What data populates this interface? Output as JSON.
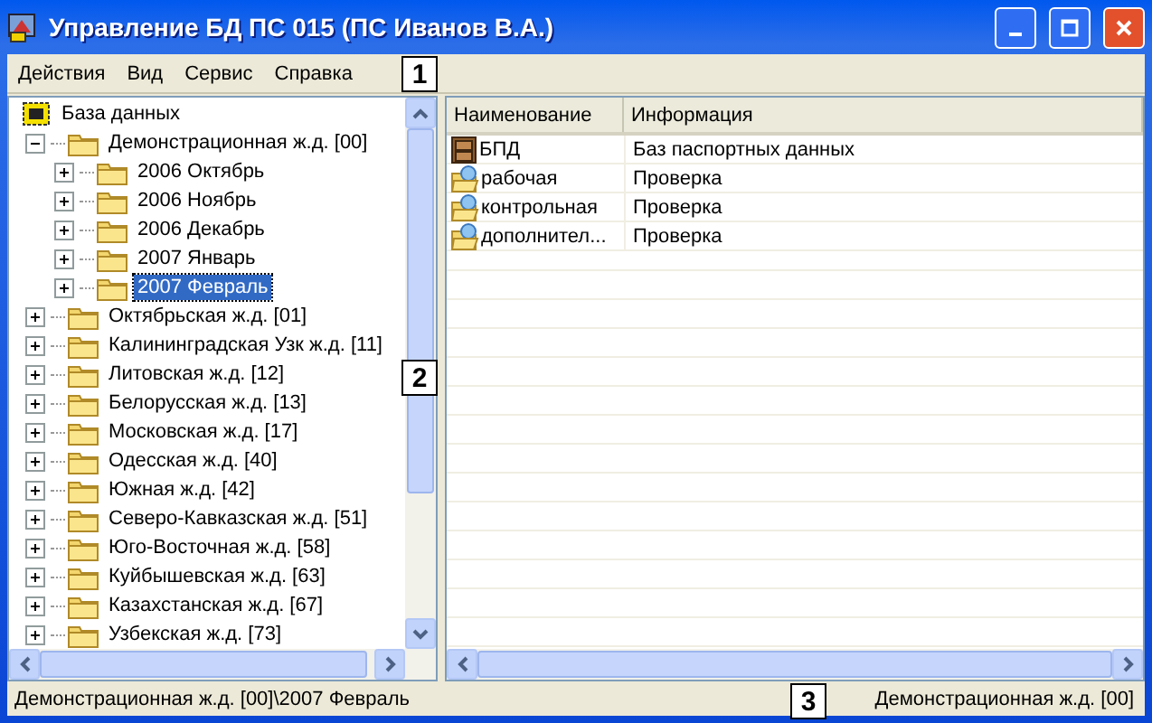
{
  "window": {
    "title": "Управление БД ПС 015 (ПС Иванов В.А.)"
  },
  "menu": [
    "Действия",
    "Вид",
    "Сервис",
    "Справка"
  ],
  "tree": {
    "label": "База данных",
    "selected": false,
    "children": [
      {
        "label": "Демонстрационная ж.д. [00]",
        "expanded": true,
        "selected": false,
        "children": [
          {
            "label": "2006 Октябрь",
            "expanded": false,
            "selected": false
          },
          {
            "label": "2006 Ноябрь",
            "expanded": false,
            "selected": false
          },
          {
            "label": "2006 Декабрь",
            "expanded": false,
            "selected": false
          },
          {
            "label": "2007 Январь",
            "expanded": false,
            "selected": false
          },
          {
            "label": "2007 Февраль",
            "expanded": false,
            "selected": true
          }
        ]
      },
      {
        "label": "Октябрьская ж.д. [01]",
        "expanded": false,
        "selected": false
      },
      {
        "label": "Калининградская Узк ж.д. [11]",
        "expanded": false,
        "selected": false
      },
      {
        "label": "Литовская ж.д. [12]",
        "expanded": false,
        "selected": false
      },
      {
        "label": "Белорусская ж.д. [13]",
        "expanded": false,
        "selected": false
      },
      {
        "label": "Московская ж.д. [17]",
        "expanded": false,
        "selected": false
      },
      {
        "label": "Одесская ж.д. [40]",
        "expanded": false,
        "selected": false
      },
      {
        "label": "Южная ж.д. [42]",
        "expanded": false,
        "selected": false
      },
      {
        "label": "Северо-Кавказская ж.д. [51]",
        "expanded": false,
        "selected": false
      },
      {
        "label": "Юго-Восточная ж.д. [58]",
        "expanded": false,
        "selected": false
      },
      {
        "label": "Куйбышевская ж.д. [63]",
        "expanded": false,
        "selected": false
      },
      {
        "label": "Казахстанская ж.д. [67]",
        "expanded": false,
        "selected": false
      },
      {
        "label": "Узбекская ж.д. [73]",
        "expanded": false,
        "selected": false
      }
    ]
  },
  "table": {
    "columns": [
      "Наименование",
      "Информация"
    ],
    "rows": [
      {
        "kind": "cabinet",
        "name": "БПД",
        "info": "Баз паспортных данных"
      },
      {
        "kind": "folder",
        "name": "рабочая",
        "info": "Проверка"
      },
      {
        "kind": "folder",
        "name": "контрольная",
        "info": "Проверка"
      },
      {
        "kind": "folder",
        "name": "дополнител...",
        "info": "Проверка"
      }
    ]
  },
  "status_bar": {
    "path": "Демонстрационная ж.д. [00]\\2007 Февраль",
    "current": "Демонстрационная ж.д. [00]"
  },
  "callouts": [
    "1",
    "2",
    "3"
  ]
}
